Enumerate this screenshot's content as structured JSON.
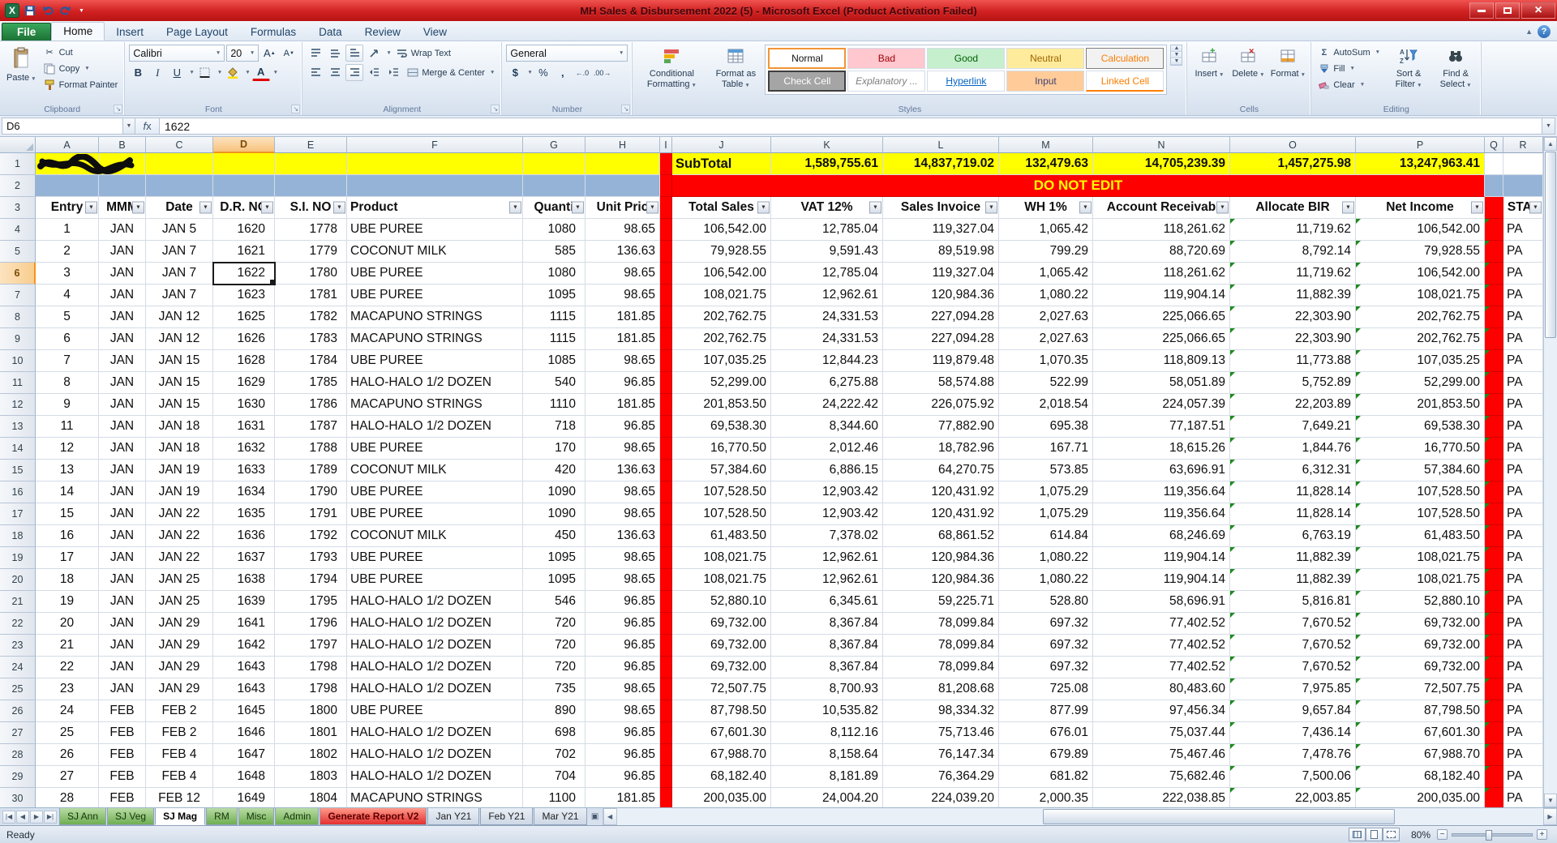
{
  "window": {
    "title": "MH Sales & Disbursement 2022 (5) -  Microsoft Excel (Product Activation Failed)"
  },
  "ribbon": {
    "tabs": [
      {
        "label": "File"
      },
      {
        "label": "Home"
      },
      {
        "label": "Insert"
      },
      {
        "label": "Page Layout"
      },
      {
        "label": "Formulas"
      },
      {
        "label": "Data"
      },
      {
        "label": "Review"
      },
      {
        "label": "View"
      }
    ],
    "active_tab": "Home",
    "clipboard": {
      "label": "Clipboard",
      "paste": "Paste",
      "cut": "Cut",
      "copy": "Copy",
      "format_painter": "Format Painter"
    },
    "font": {
      "label": "Font",
      "family": "Calibri",
      "size": "20"
    },
    "alignment": {
      "label": "Alignment",
      "wrap_text": "Wrap Text",
      "merge_center": "Merge & Center"
    },
    "number": {
      "label": "Number",
      "format": "General"
    },
    "styles": {
      "label": "Styles",
      "conditional_formatting": "Conditional Formatting",
      "format_as_table": "Format as Table",
      "gallery": [
        "Normal",
        "Bad",
        "Good",
        "Neutral",
        "Calculation",
        "Check Cell",
        "Explanatory ...",
        "Hyperlink",
        "Input",
        "Linked Cell"
      ]
    },
    "cells": {
      "label": "Cells",
      "insert": "Insert",
      "delete": "Delete",
      "format": "Format"
    },
    "editing": {
      "label": "Editing",
      "autosum": "AutoSum",
      "fill": "Fill",
      "clear": "Clear",
      "sort_filter": "Sort & Filter",
      "find_select": "Find & Select"
    }
  },
  "formula_bar": {
    "name_box": "D6",
    "value": "1622"
  },
  "sheet": {
    "col_letters": [
      "A",
      "B",
      "C",
      "D",
      "E",
      "F",
      "G",
      "H",
      "I",
      "J",
      "K",
      "L",
      "M",
      "N",
      "O",
      "P",
      "Q",
      "R"
    ],
    "selected": {
      "col": "D",
      "row": 6
    },
    "subtotal": {
      "label": "SubTotal",
      "values": {
        "K": "1,589,755.61",
        "L": "14,837,719.02",
        "M": "132,479.63",
        "N": "14,705,239.39",
        "O": "1,457,275.98",
        "P": "13,247,963.41"
      }
    },
    "banner": "DO NOT EDIT",
    "headers": [
      "Entry",
      "MMM",
      "Date",
      "D.R. NO",
      "S.I. NO",
      "Product",
      "Quanti",
      "Unit Pric",
      "Total Sales",
      "VAT 12%",
      "Sales Invoice",
      "WH 1%",
      "Account Receivab",
      "Allocate BIR",
      "Net Income",
      "STAT"
    ],
    "rows": [
      [
        "1",
        "JAN",
        "JAN 5",
        "1620",
        "1778",
        "UBE PUREE",
        "1080",
        "98.65",
        "106,542.00",
        "12,785.04",
        "119,327.04",
        "1,065.42",
        "118,261.62",
        "11,719.62",
        "106,542.00",
        "PA"
      ],
      [
        "2",
        "JAN",
        "JAN 7",
        "1621",
        "1779",
        "COCONUT MILK",
        "585",
        "136.63",
        "79,928.55",
        "9,591.43",
        "89,519.98",
        "799.29",
        "88,720.69",
        "8,792.14",
        "79,928.55",
        "PA"
      ],
      [
        "3",
        "JAN",
        "JAN 7",
        "1622",
        "1780",
        "UBE PUREE",
        "1080",
        "98.65",
        "106,542.00",
        "12,785.04",
        "119,327.04",
        "1,065.42",
        "118,261.62",
        "11,719.62",
        "106,542.00",
        "PA"
      ],
      [
        "4",
        "JAN",
        "JAN 7",
        "1623",
        "1781",
        "UBE PUREE",
        "1095",
        "98.65",
        "108,021.75",
        "12,962.61",
        "120,984.36",
        "1,080.22",
        "119,904.14",
        "11,882.39",
        "108,021.75",
        "PA"
      ],
      [
        "5",
        "JAN",
        "JAN 12",
        "1625",
        "1782",
        "MACAPUNO STRINGS",
        "1115",
        "181.85",
        "202,762.75",
        "24,331.53",
        "227,094.28",
        "2,027.63",
        "225,066.65",
        "22,303.90",
        "202,762.75",
        "PA"
      ],
      [
        "6",
        "JAN",
        "JAN 12",
        "1626",
        "1783",
        "MACAPUNO STRINGS",
        "1115",
        "181.85",
        "202,762.75",
        "24,331.53",
        "227,094.28",
        "2,027.63",
        "225,066.65",
        "22,303.90",
        "202,762.75",
        "PA"
      ],
      [
        "7",
        "JAN",
        "JAN 15",
        "1628",
        "1784",
        "UBE PUREE",
        "1085",
        "98.65",
        "107,035.25",
        "12,844.23",
        "119,879.48",
        "1,070.35",
        "118,809.13",
        "11,773.88",
        "107,035.25",
        "PA"
      ],
      [
        "8",
        "JAN",
        "JAN 15",
        "1629",
        "1785",
        "HALO-HALO 1/2 DOZEN",
        "540",
        "96.85",
        "52,299.00",
        "6,275.88",
        "58,574.88",
        "522.99",
        "58,051.89",
        "5,752.89",
        "52,299.00",
        "PA"
      ],
      [
        "9",
        "JAN",
        "JAN 15",
        "1630",
        "1786",
        "MACAPUNO STRINGS",
        "1110",
        "181.85",
        "201,853.50",
        "24,222.42",
        "226,075.92",
        "2,018.54",
        "224,057.39",
        "22,203.89",
        "201,853.50",
        "PA"
      ],
      [
        "11",
        "JAN",
        "JAN 18",
        "1631",
        "1787",
        "HALO-HALO 1/2 DOZEN",
        "718",
        "96.85",
        "69,538.30",
        "8,344.60",
        "77,882.90",
        "695.38",
        "77,187.51",
        "7,649.21",
        "69,538.30",
        "PA"
      ],
      [
        "12",
        "JAN",
        "JAN 18",
        "1632",
        "1788",
        "UBE PUREE",
        "170",
        "98.65",
        "16,770.50",
        "2,012.46",
        "18,782.96",
        "167.71",
        "18,615.26",
        "1,844.76",
        "16,770.50",
        "PA"
      ],
      [
        "13",
        "JAN",
        "JAN 19",
        "1633",
        "1789",
        "COCONUT MILK",
        "420",
        "136.63",
        "57,384.60",
        "6,886.15",
        "64,270.75",
        "573.85",
        "63,696.91",
        "6,312.31",
        "57,384.60",
        "PA"
      ],
      [
        "14",
        "JAN",
        "JAN 19",
        "1634",
        "1790",
        "UBE PUREE",
        "1090",
        "98.65",
        "107,528.50",
        "12,903.42",
        "120,431.92",
        "1,075.29",
        "119,356.64",
        "11,828.14",
        "107,528.50",
        "PA"
      ],
      [
        "15",
        "JAN",
        "JAN 22",
        "1635",
        "1791",
        "UBE PUREE",
        "1090",
        "98.65",
        "107,528.50",
        "12,903.42",
        "120,431.92",
        "1,075.29",
        "119,356.64",
        "11,828.14",
        "107,528.50",
        "PA"
      ],
      [
        "16",
        "JAN",
        "JAN 22",
        "1636",
        "1792",
        "COCONUT MILK",
        "450",
        "136.63",
        "61,483.50",
        "7,378.02",
        "68,861.52",
        "614.84",
        "68,246.69",
        "6,763.19",
        "61,483.50",
        "PA"
      ],
      [
        "17",
        "JAN",
        "JAN 22",
        "1637",
        "1793",
        "UBE PUREE",
        "1095",
        "98.65",
        "108,021.75",
        "12,962.61",
        "120,984.36",
        "1,080.22",
        "119,904.14",
        "11,882.39",
        "108,021.75",
        "PA"
      ],
      [
        "18",
        "JAN",
        "JAN 25",
        "1638",
        "1794",
        "UBE PUREE",
        "1095",
        "98.65",
        "108,021.75",
        "12,962.61",
        "120,984.36",
        "1,080.22",
        "119,904.14",
        "11,882.39",
        "108,021.75",
        "PA"
      ],
      [
        "19",
        "JAN",
        "JAN 25",
        "1639",
        "1795",
        "HALO-HALO 1/2 DOZEN",
        "546",
        "96.85",
        "52,880.10",
        "6,345.61",
        "59,225.71",
        "528.80",
        "58,696.91",
        "5,816.81",
        "52,880.10",
        "PA"
      ],
      [
        "20",
        "JAN",
        "JAN 29",
        "1641",
        "1796",
        "HALO-HALO 1/2 DOZEN",
        "720",
        "96.85",
        "69,732.00",
        "8,367.84",
        "78,099.84",
        "697.32",
        "77,402.52",
        "7,670.52",
        "69,732.00",
        "PA"
      ],
      [
        "21",
        "JAN",
        "JAN 29",
        "1642",
        "1797",
        "HALO-HALO 1/2 DOZEN",
        "720",
        "96.85",
        "69,732.00",
        "8,367.84",
        "78,099.84",
        "697.32",
        "77,402.52",
        "7,670.52",
        "69,732.00",
        "PA"
      ],
      [
        "22",
        "JAN",
        "JAN 29",
        "1643",
        "1798",
        "HALO-HALO 1/2 DOZEN",
        "720",
        "96.85",
        "69,732.00",
        "8,367.84",
        "78,099.84",
        "697.32",
        "77,402.52",
        "7,670.52",
        "69,732.00",
        "PA"
      ],
      [
        "23",
        "JAN",
        "JAN 29",
        "1643",
        "1798",
        "HALO-HALO 1/2 DOZEN",
        "735",
        "98.65",
        "72,507.75",
        "8,700.93",
        "81,208.68",
        "725.08",
        "80,483.60",
        "7,975.85",
        "72,507.75",
        "PA"
      ],
      [
        "24",
        "FEB",
        "FEB 2",
        "1645",
        "1800",
        "UBE PUREE",
        "890",
        "98.65",
        "87,798.50",
        "10,535.82",
        "98,334.32",
        "877.99",
        "97,456.34",
        "9,657.84",
        "87,798.50",
        "PA"
      ],
      [
        "25",
        "FEB",
        "FEB 2",
        "1646",
        "1801",
        "HALO-HALO 1/2 DOZEN",
        "698",
        "96.85",
        "67,601.30",
        "8,112.16",
        "75,713.46",
        "676.01",
        "75,037.44",
        "7,436.14",
        "67,601.30",
        "PA"
      ],
      [
        "26",
        "FEB",
        "FEB 4",
        "1647",
        "1802",
        "HALO-HALO 1/2 DOZEN",
        "702",
        "96.85",
        "67,988.70",
        "8,158.64",
        "76,147.34",
        "679.89",
        "75,467.46",
        "7,478.76",
        "67,988.70",
        "PA"
      ],
      [
        "27",
        "FEB",
        "FEB 4",
        "1648",
        "1803",
        "HALO-HALO 1/2 DOZEN",
        "704",
        "96.85",
        "68,182.40",
        "8,181.89",
        "76,364.29",
        "681.82",
        "75,682.46",
        "7,500.06",
        "68,182.40",
        "PA"
      ],
      [
        "28",
        "FEB",
        "FEB 12",
        "1649",
        "1804",
        "MACAPUNO STRINGS",
        "1100",
        "181.85",
        "200,035.00",
        "24,004.20",
        "224,039.20",
        "2,000.35",
        "222,038.85",
        "22,003.85",
        "200,035.00",
        "PA"
      ]
    ]
  },
  "sheet_tabs": [
    {
      "label": "SJ Ann",
      "color": "green"
    },
    {
      "label": "SJ Veg",
      "color": "green"
    },
    {
      "label": "SJ Mag",
      "color": "plain",
      "active": true
    },
    {
      "label": "RM",
      "color": "green"
    },
    {
      "label": "Misc",
      "color": "green"
    },
    {
      "label": "Admin",
      "color": "green"
    },
    {
      "label": "Generate Report V2",
      "color": "red"
    },
    {
      "label": "Jan Y21",
      "color": "plain"
    },
    {
      "label": "Feb Y21",
      "color": "plain"
    },
    {
      "label": "Mar Y21",
      "color": "plain"
    }
  ],
  "status": {
    "ready": "Ready",
    "zoom": "80%"
  },
  "colors": {
    "accent_red": "#ff0000",
    "subtotal_yellow": "#ffff00",
    "row2_blue": "#95b3d7",
    "tab_green": "#6fae52",
    "tab_red": "#e23030",
    "titlebar_red": "#d02020"
  }
}
